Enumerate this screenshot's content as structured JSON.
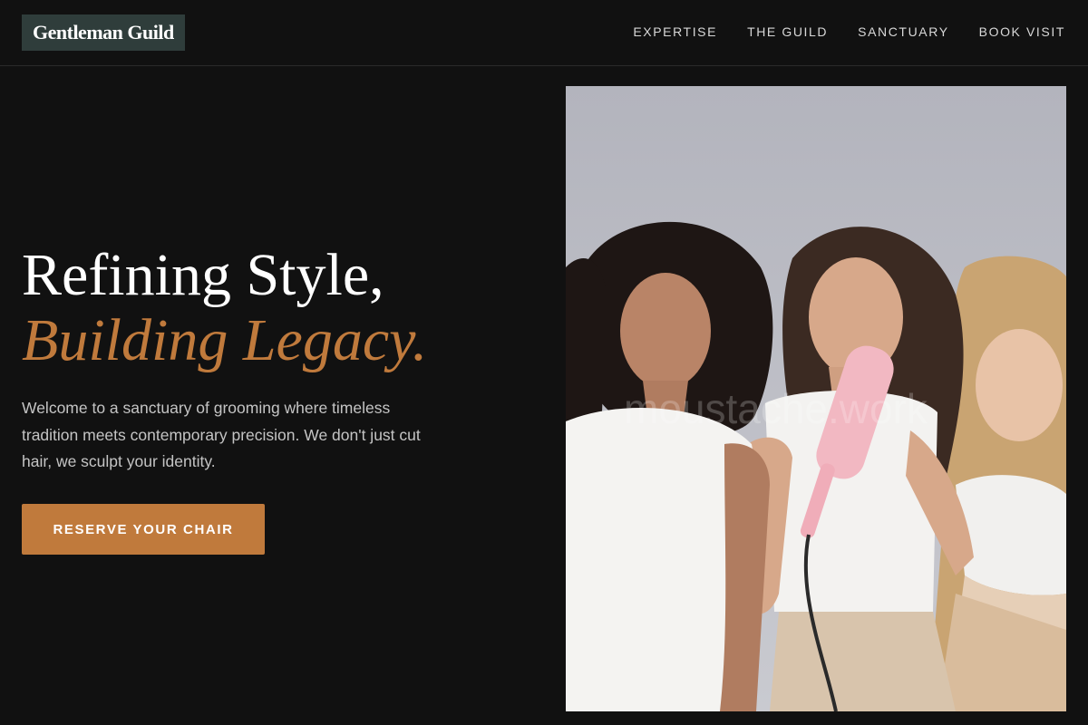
{
  "brand": {
    "name": "Gentleman Guild"
  },
  "nav": {
    "items": [
      {
        "label": "EXPERTISE"
      },
      {
        "label": "THE GUILD"
      },
      {
        "label": "SANCTUARY"
      },
      {
        "label": "BOOK VISIT"
      }
    ]
  },
  "hero": {
    "title_line1": "Refining Style,",
    "title_line2": "Building Legacy.",
    "description": "Welcome to a sanctuary of grooming where timeless tradition meets contemporary precision. We don't just cut hair, we sculpt your identity.",
    "cta_label": "RESERVE YOUR CHAIR",
    "image": {
      "subject": "three women in white tops, one holding a pink hair straightener",
      "watermark": "moustache.work"
    }
  },
  "colors": {
    "background": "#111111",
    "accent": "#c07a3c",
    "logo_bg": "#2f3d3b",
    "text_muted": "#c4c4c4"
  }
}
